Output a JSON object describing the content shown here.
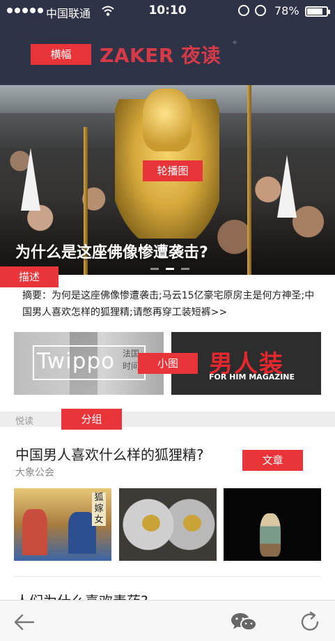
{
  "status_bar": {
    "carrier": "中国联通",
    "time": "10:10",
    "battery": "78%"
  },
  "header": {
    "brand": "ZAKER 夜读",
    "banner_tag": "横幅"
  },
  "carousel": {
    "tag": "轮播图",
    "title": "为什么是这座佛像惨遭袭击?",
    "active_index": 1,
    "page_count": 3
  },
  "description": {
    "tag": "描述",
    "text": "摘要：为何是这座佛像惨遭袭击;马云15亿豪宅原房主是何方神圣;中国男人喜欢怎样的狐狸精;请憋再穿工装短裤>>"
  },
  "thumbnails": {
    "tag": "小图",
    "left": {
      "brand": "Twippo",
      "side": "法国时间"
    },
    "right": {
      "title": "男人装",
      "subtitle": "FOR HIM MAGAZINE"
    }
  },
  "group": {
    "tag": "分组",
    "label": "悦读"
  },
  "article": {
    "tag": "文章",
    "title": "中国男人喜欢什么样的狐狸精?",
    "source": "大象公会",
    "image1_caption": "狐嫁女"
  },
  "next_article": {
    "title": "人们为什么喜欢毒药?"
  },
  "colors": {
    "header_bg": "#2f3347",
    "brand_red": "#d43a47",
    "tag_red": "#e9353a"
  },
  "toolbar": {
    "icons": [
      "back-arrow-icon",
      "wechat-icon",
      "refresh-icon"
    ]
  }
}
